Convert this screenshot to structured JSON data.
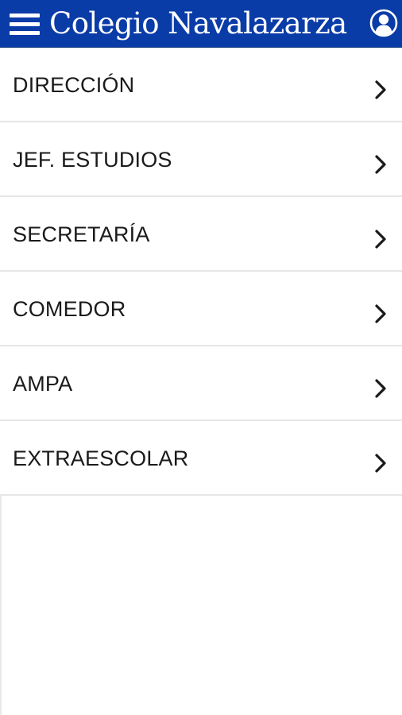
{
  "colors": {
    "app_bar": "#0a3ca8",
    "app_bar_text": "#ffffff",
    "item_text": "#1a1a1a",
    "divider": "#e6e6e6",
    "chevron": "#1a1a1a"
  },
  "header": {
    "title": "Colegio Navalazarza",
    "menu_icon": "hamburger-menu-icon",
    "profile_icon": "user-circle-icon"
  },
  "menu": {
    "items": [
      {
        "label": "DIRECCIÓN",
        "icon": "chevron-right-icon"
      },
      {
        "label": "JEF. ESTUDIOS",
        "icon": "chevron-right-icon"
      },
      {
        "label": "SECRETARÍA",
        "icon": "chevron-right-icon"
      },
      {
        "label": "COMEDOR",
        "icon": "chevron-right-icon"
      },
      {
        "label": "AMPA",
        "icon": "chevron-right-icon"
      },
      {
        "label": "EXTRAESCOLAR",
        "icon": "chevron-right-icon"
      }
    ]
  }
}
